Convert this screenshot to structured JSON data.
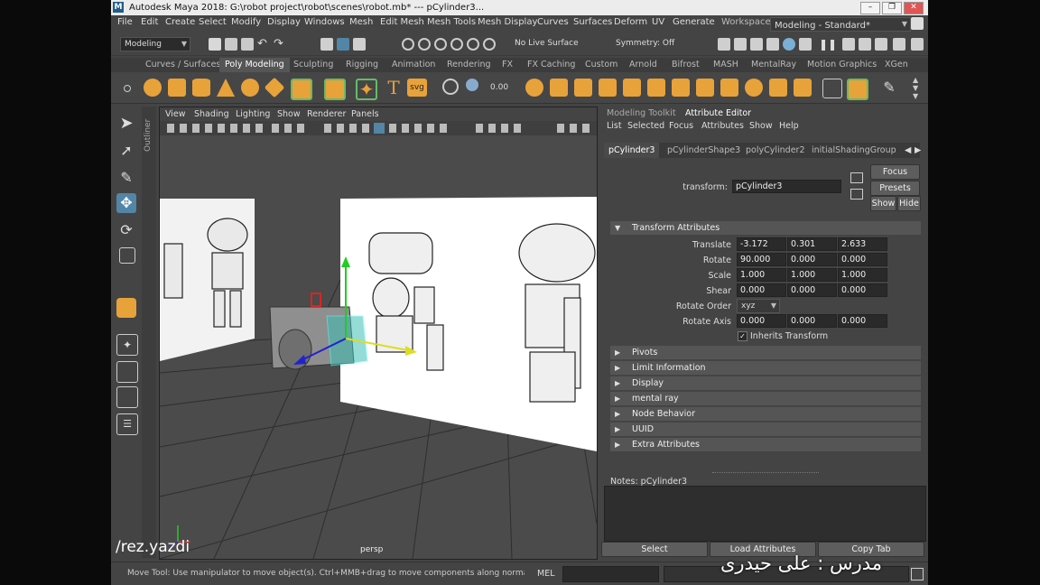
{
  "title": "Autodesk Maya 2018: G:\\robot project\\robot\\scenes\\robot.mb*  ---   pCylinder3...",
  "menus": [
    "File",
    "Edit",
    "Create",
    "Select",
    "Modify",
    "Display",
    "Windows",
    "Mesh",
    "Edit Mesh",
    "Mesh Tools",
    "Mesh Display",
    "Curves",
    "Surfaces",
    "Deform",
    "UV",
    "Generate"
  ],
  "workspace_label": "Workspace :",
  "workspace_value": "Modeling - Standard*",
  "menuset": "Modeling",
  "live_surface": "No Live Surface",
  "symmetry": "Symmetry: Off",
  "shelf_tabs": [
    "Curves / Surfaces",
    "Poly Modeling",
    "Sculpting",
    "Rigging",
    "Animation",
    "Rendering",
    "FX",
    "FX Caching",
    "Custom",
    "Arnold",
    "Bifrost",
    "MASH",
    "MentalRay",
    "Motion Graphics",
    "XGen"
  ],
  "shelf_svg_label": "svg",
  "viewport_menus": [
    "View",
    "Shading",
    "Lighting",
    "Show",
    "Renderer",
    "Panels"
  ],
  "camera": "persp",
  "outliner_label": "Outliner",
  "panel_tabs": [
    "Modeling Toolkit",
    "Attribute Editor"
  ],
  "attr_menus": [
    "List",
    "Selected",
    "Focus",
    "Attributes",
    "Show",
    "Help"
  ],
  "node_tabs": [
    "pCylinder3",
    "pCylinderShape3",
    "polyCylinder2",
    "initialShadingGroup"
  ],
  "transform_label": "transform:",
  "transform_value": "pCylinder3",
  "buttons": {
    "focus": "Focus",
    "presets": "Presets",
    "show": "Show",
    "hide": "Hide"
  },
  "transform_section": "Transform Attributes",
  "attrs": {
    "translate": {
      "label": "Translate",
      "x": "-3.172",
      "y": "0.301",
      "z": "2.633"
    },
    "rotate": {
      "label": "Rotate",
      "x": "90.000",
      "y": "0.000",
      "z": "0.000"
    },
    "scale": {
      "label": "Scale",
      "x": "1.000",
      "y": "1.000",
      "z": "1.000"
    },
    "shear": {
      "label": "Shear",
      "x": "0.000",
      "y": "0.000",
      "z": "0.000"
    },
    "rotate_order": {
      "label": "Rotate Order",
      "value": "xyz"
    },
    "rotate_axis": {
      "label": "Rotate Axis",
      "x": "0.000",
      "y": "0.000",
      "z": "0.000"
    },
    "inherits": "Inherits Transform"
  },
  "sections": [
    "Pivots",
    "Limit Information",
    "Display",
    "mental ray",
    "Node Behavior",
    "UUID",
    "Extra Attributes"
  ],
  "notes_label": "Notes:  pCylinder3",
  "bottom_buttons": [
    "Select",
    "Load Attributes",
    "Copy Tab"
  ],
  "status_message": "Move Tool: Use manipulator to move object(s). Ctrl+MMB+drag to move components along normals. Shift+drag manipulato",
  "mel_label": "MEL",
  "watermark": "/rez.yazdi",
  "teacher_text": "مدرس : علی حیدری",
  "colors": {
    "panel": "#444444",
    "viewport": "#4b4b4b",
    "highlight": "#5285a6",
    "accent": "#e8a23a"
  }
}
